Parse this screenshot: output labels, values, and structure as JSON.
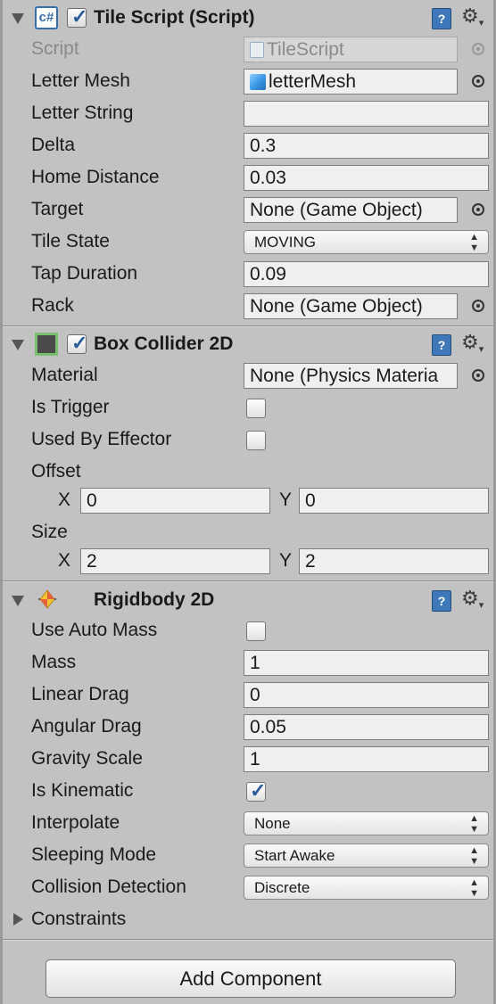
{
  "tile_script": {
    "title": "Tile Script (Script)",
    "fields": {
      "script_label": "Script",
      "script_value": "TileScript",
      "letter_mesh_label": "Letter Mesh",
      "letter_mesh_value": "letterMesh",
      "letter_string_label": "Letter String",
      "letter_string_value": "",
      "delta_label": "Delta",
      "delta_value": "0.3",
      "home_distance_label": "Home Distance",
      "home_distance_value": "0.03",
      "target_label": "Target",
      "target_value": "None (Game Object)",
      "tile_state_label": "Tile State",
      "tile_state_value": "MOVING",
      "tap_duration_label": "Tap Duration",
      "tap_duration_value": "0.09",
      "rack_label": "Rack",
      "rack_value": "None (Game Object)"
    }
  },
  "box_collider": {
    "title": "Box Collider 2D",
    "material_label": "Material",
    "material_value": "None (Physics Materia",
    "is_trigger_label": "Is Trigger",
    "is_trigger_checked": false,
    "used_by_effector_label": "Used By Effector",
    "used_by_effector_checked": false,
    "offset_label": "Offset",
    "offset_x_label": "X",
    "offset_x_value": "0",
    "offset_y_label": "Y",
    "offset_y_value": "0",
    "size_label": "Size",
    "size_x_label": "X",
    "size_x_value": "2",
    "size_y_label": "Y",
    "size_y_value": "2"
  },
  "rigidbody": {
    "title": "Rigidbody 2D",
    "use_auto_mass_label": "Use Auto Mass",
    "use_auto_mass_checked": false,
    "mass_label": "Mass",
    "mass_value": "1",
    "linear_drag_label": "Linear Drag",
    "linear_drag_value": "0",
    "angular_drag_label": "Angular Drag",
    "angular_drag_value": "0.05",
    "gravity_scale_label": "Gravity Scale",
    "gravity_scale_value": "1",
    "is_kinematic_label": "Is Kinematic",
    "is_kinematic_checked": true,
    "interpolate_label": "Interpolate",
    "interpolate_value": "None",
    "sleeping_mode_label": "Sleeping Mode",
    "sleeping_mode_value": "Start Awake",
    "collision_detection_label": "Collision Detection",
    "collision_detection_value": "Discrete",
    "constraints_label": "Constraints"
  },
  "header_icons": {
    "script_icon_glyph": "c#",
    "help_glyph": "?",
    "gear_glyph": "⚙",
    "check_glyph": "✓"
  },
  "add_component_label": "Add Component",
  "colors": {
    "panel_bg": "#c2c2c2",
    "field_bg": "#efefef",
    "check_blue": "#2a5c9a",
    "help_blue": "#3f78b8"
  }
}
